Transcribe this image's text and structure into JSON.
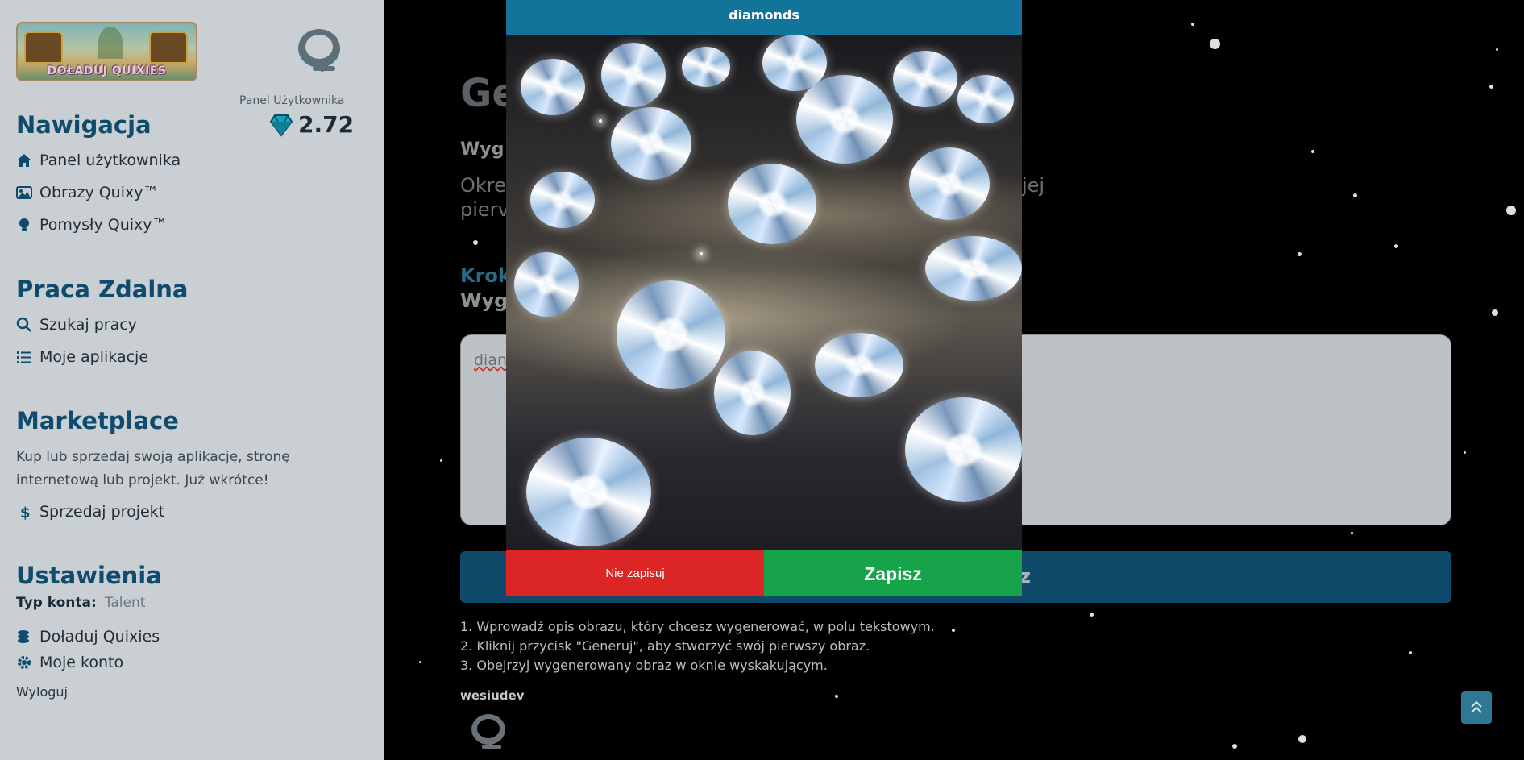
{
  "sidebar": {
    "banner_text": "DOŁADUJ QUIXIES",
    "panel_label": "Panel Użytkownika",
    "balance": "2.72",
    "nav": {
      "title": "Nawigacja",
      "items": [
        {
          "label": "Panel użytkownika",
          "icon": "home-icon"
        },
        {
          "label": "Obrazy Quixy™",
          "icon": "image-icon"
        },
        {
          "label": "Pomysły Quixy™",
          "icon": "lightbulb-icon"
        }
      ]
    },
    "remote": {
      "title": "Praca Zdalna",
      "items": [
        {
          "label": "Szukaj pracy",
          "icon": "search-icon"
        },
        {
          "label": "Moje aplikacje",
          "icon": "list-icon"
        }
      ]
    },
    "marketplace": {
      "title": "Marketplace",
      "description_line1": "Kup lub sprzedaj swoją aplikację, stronę",
      "description_line2": "internetową lub projekt. Już wkrótce!",
      "sell_label": "Sprzedaj projekt"
    },
    "settings": {
      "title": "Ustawienia",
      "account_type_label": "Typ konta:",
      "account_type_value": "Talent",
      "items": [
        {
          "label": "Doładuj Quixies",
          "icon": "coins-icon"
        },
        {
          "label": "Moje konto",
          "icon": "gear-icon"
        }
      ],
      "logout": "Wyloguj"
    }
  },
  "main": {
    "title_partial": "Ge",
    "subtitle_partial": "Wyg",
    "description_line1_start": "Okre",
    "description_line1_end": "zyć na swojej",
    "description_line2_start": "pierv",
    "step_label_partial": "Krok",
    "step_heading_partial": "Wyg",
    "prompt_value_partial": "dian",
    "generate_partial": "az",
    "instructions": [
      "1. Wprowadź opis obrazu, który chcesz wygenerować, w polu tekstowym.",
      "2. Kliknij przycisk \"Generuj\", aby stworzyć swój pierwszy obraz.",
      "3. Obejrzyj wygenerowany obraz w oknie wyskakującym."
    ],
    "author": "wesiudev"
  },
  "modal": {
    "title": "diamonds",
    "reject_label": "Nie zapisuj",
    "save_label": "Zapisz"
  },
  "colors": {
    "accent": "#12739b",
    "danger": "#dc2626",
    "success": "#16a34a",
    "sidebar_bg": "#c9cfd3",
    "heading": "#0e4b6d"
  }
}
